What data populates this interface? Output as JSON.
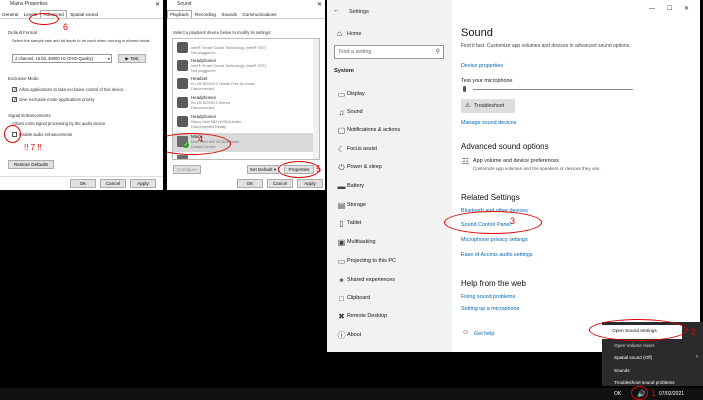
{
  "win1": {
    "title": "Mains Properties",
    "tabs": [
      "General",
      "Levels",
      "Advanced",
      "Spatial sound"
    ],
    "default_format_header": "Default Format",
    "default_format_desc": "Select the sample rate and bit depth to be used when running in shared mode.",
    "format_value": "2 channel, 16 bit, 48000 Hz (DVD Quality)",
    "test_label": "▶ Test",
    "exclusive_header": "Exclusive Mode",
    "exclusive_opt1": "Allow applications to take exclusive control of this device",
    "exclusive_opt2": "Give exclusive mode applications priority",
    "signal_header": "Signal Enhancements",
    "signal_desc": "Allows extra signal processing by the audio device",
    "enable_enh": "Enable audio enhancements",
    "marker_7": "!! 7 !!",
    "marker_6": "6",
    "restore_label": "Restore Defaults",
    "ok": "OK",
    "cancel": "Cancel",
    "apply": "Apply"
  },
  "win2": {
    "title": "Sound",
    "tabs": [
      "Playback",
      "Recording",
      "Sounds",
      "Communications"
    ],
    "instr": "Select a playback device below to modify its settings:",
    "devices": [
      {
        "name": "",
        "l2": "Intel® Smart Sound Technology (Intel® SST)",
        "l3": "Not plugged in"
      },
      {
        "name": "Headphones",
        "l2": "Intel® Smart Sound Technology (Intel® SST)",
        "l3": "Not plugged in"
      },
      {
        "name": "Headset",
        "l2": "Ku UK BOOM 2 Hands-Free Au Audio",
        "l3": "Disconnected"
      },
      {
        "name": "Headphones",
        "l2": "Ku UK BOOM 2 Stereo",
        "l3": "Disconnected"
      },
      {
        "name": "Headphones",
        "l2": "Mains Nimi MI2 NVIDIA Audio",
        "l3": "Disconnected Ready"
      },
      {
        "name": "Mains",
        "l2": "Main Nimi MI2 NVIDIA Audio",
        "l3": "Default Device"
      },
      {
        "name": "",
        "l2": "",
        "l3": ""
      }
    ],
    "marker_4": "4",
    "marker_5": "5",
    "configure": "Configure",
    "set_default": "Set Default ▾",
    "properties": "Properties",
    "ok": "OK",
    "cancel": "Cancel",
    "apply": "Apply"
  },
  "settings": {
    "title": "Settings",
    "home": "Home",
    "search_placeholder": "Find a setting",
    "section": "System",
    "nav": [
      {
        "icon": "▭",
        "label": "Display"
      },
      {
        "icon": "♫",
        "label": "Sound"
      },
      {
        "icon": "▢",
        "label": "Notifications & actions"
      },
      {
        "icon": "☾",
        "label": "Focus assist"
      },
      {
        "icon": "⏻",
        "label": "Power & sleep"
      },
      {
        "icon": "▬",
        "label": "Battery"
      },
      {
        "icon": "▤",
        "label": "Storage"
      },
      {
        "icon": "▯",
        "label": "Tablet"
      },
      {
        "icon": "▣",
        "label": "Multitasking"
      },
      {
        "icon": "▭",
        "label": "Projecting to this PC"
      },
      {
        "icon": "✶",
        "label": "Shared experiences"
      },
      {
        "icon": "□",
        "label": "Clipboard"
      },
      {
        "icon": "✖",
        "label": "Remote Desktop"
      },
      {
        "icon": "ⓘ",
        "label": "About"
      }
    ],
    "sound_title": "Sound",
    "sound_desc": "Find it fast. Customize app volumes and devices in advanced sound options.",
    "device_props": "Device properties",
    "test_mic": "Test your microphone",
    "troubleshoot": "Troubleshoot",
    "manage_devices": "Manage sound devices",
    "adv_title": "Advanced sound options",
    "app_vol": "App volume and device preferences",
    "app_vol_desc": "Customize app volumes and the speakers or devices they use.",
    "related_title": "Related Settings",
    "related_links": [
      "Bluetooth and other devices",
      "Sound Control Panel",
      "Microphone privacy settings",
      "Ease of Access audio settings"
    ],
    "marker_3": "3",
    "help_title": "Help from the web",
    "help_links": [
      "Fixing sound problems",
      "Setting up a microphone"
    ],
    "get_help": "Get help"
  },
  "tray_menu": {
    "items": [
      "Open Sound settings",
      "Open Volume mixer",
      "Spatial sound (Off)",
      "Sounds",
      "Troubleshoot sound problems"
    ],
    "marker_2": "2",
    "marker_1": "1",
    "ok": "OK",
    "date": "07/02/2021"
  },
  "colors": {
    "accent": "#0067b8",
    "annotation": "#e00000",
    "selected": "#cce4f7",
    "sidebar": "#f2f2f2"
  }
}
